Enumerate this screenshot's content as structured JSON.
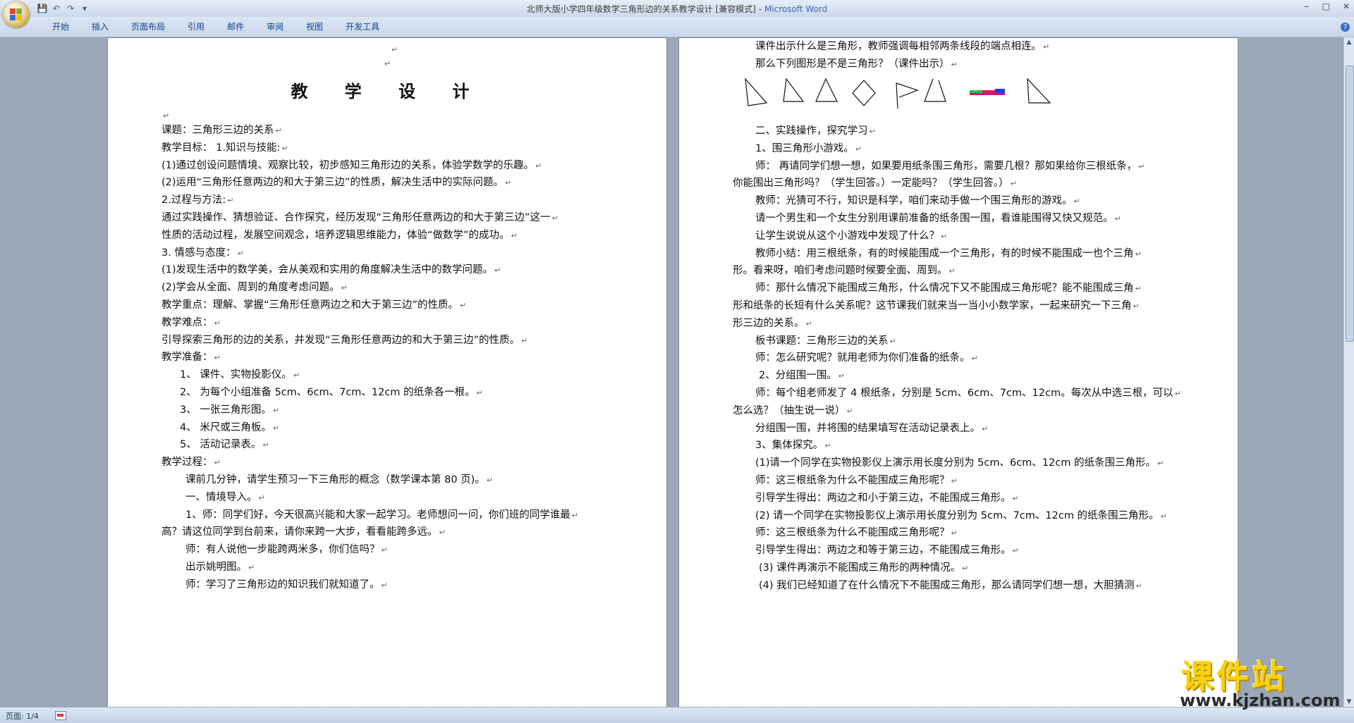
{
  "window": {
    "title": "北师大版小学四年级数学三角形边的关系教学设计 [兼容模式]",
    "app_name": "Microsoft Word"
  },
  "ribbon": {
    "tabs": [
      "开始",
      "插入",
      "页面布局",
      "引用",
      "邮件",
      "审阅",
      "视图",
      "开发工具"
    ]
  },
  "page1": {
    "title": "教 学 设 计",
    "lines": [
      "课题：三角形三边的关系",
      "教学目标： 1.知识与技能:",
      "(1)通过创设问题情境、观察比较，初步感知三角形边的关系，体验学数学的乐趣。",
      "(2)运用“三角形任意两边的和大于第三边”的性质，解决生活中的实际问题。",
      "2.过程与方法:",
      "通过实践操作、猜想验证、合作探究，经历发现“三角形任意两边的和大于第三边”这一",
      "性质的活动过程，发展空间观念，培养逻辑思维能力，体验“做数学”的成功。",
      "3. 情感与态度：",
      "(1)发现生活中的数学美，会从美观和实用的角度解决生活中的数学问题。",
      "(2)学会从全面、周到的角度考虑问题。",
      "教学重点：理解、掌握“三角形任意两边之和大于第三边”的性质。",
      "教学难点：",
      "引导探索三角形的边的关系，并发现“三角形任意两边的和大于第三边”的性质。",
      "教学准备：",
      "1、 课件、实物投影仪。",
      "2、 为每个小组准备 5cm、6cm、7cm、12cm 的纸条各一根。",
      "3、 一张三角形图。",
      "4、 米尺或三角板。",
      "5、 活动记录表。",
      "教学过程：",
      "课前几分钟，请学生预习一下三角形的概念（数学课本第 80 页)。",
      "一、情境导入。",
      "1、师：同学们好，今天很高兴能和大家一起学习。老师想问一问，你们班的同学谁最",
      "高？请这位同学到台前来，请你来跨一大步，看看能跨多远。",
      "师：有人说他一步能跨两米多，你们信吗？",
      "出示姚明图。",
      "师：学习了三角形边的知识我们就知道了。"
    ]
  },
  "page2": {
    "lines_top": [
      "课件出示什么是三角形，教师强调每相邻两条线段的端点相连。",
      "那么下列图形是不是三角形？（课件出示）"
    ],
    "lines": [
      "二、实践操作，探究学习",
      "1、围三角形小游戏。",
      "师： 再请同学们想一想，如果要用纸条围三角形，需要几根？那如果给你三根纸条，",
      "你能围出三角形吗？（学生回答。）一定能吗？（学生回答。）",
      "教师：光猜可不行，知识是科学，咱们来动手做一个围三角形的游戏。",
      "请一个男生和一个女生分别用课前准备的纸条围一围，看谁能围得又快又规范。",
      "让学生说说从这个小游戏中发现了什么？",
      "教师小结：用三根纸条，有的时候能围成一个三角形，有的时候不能围成一也个三角",
      "形。看来呀，咱们考虑问题时候要全面、周到。",
      "师：那什么情况下能围成三角形，什么情况下又不能围成三角形呢？能不能围成三角",
      "形和纸条的长短有什么关系呢？这节课我们就来当一当小小数学家，一起来研究一下三角",
      "形三边的关系。",
      "板书课题：三角形三边的关系",
      "师：怎么研究呢？就用老师为你们准备的纸条。",
      "2、分组围一围。",
      "师：每个组老师发了 4 根纸条，分别是 5cm、6cm、7cm、12cm。每次从中选三根，可以",
      "怎么选？（抽生说一说）",
      "分组围一围，并将围的结果填写在活动记录表上。",
      "3、集体探究。",
      "(1)请一个同学在实物投影仪上演示用长度分别为 5cm、6cm、12cm 的纸条围三角形。",
      "师：这三根纸条为什么不能围成三角形呢？",
      "引导学生得出：两边之和小于第三边，不能围成三角形。",
      "(2) 请一个同学在实物投影仪上演示用长度分别为 5cm、7cm、12cm 的纸条围三角形。",
      "师：这三根纸条为什么不能围成三角形呢？",
      "引导学生得出：两边之和等于第三边，不能围成三角形。",
      "(3) 课件再演示不能围成三角形的两种情况。",
      "(4) 我们已经知道了在什么情况下不能围成三角形，那么请同学们想一想，大胆猜测"
    ]
  },
  "status": {
    "page_info": "页面: 1/4"
  },
  "watermark": {
    "text": "课件站",
    "url": "www.kjzhan.com"
  }
}
